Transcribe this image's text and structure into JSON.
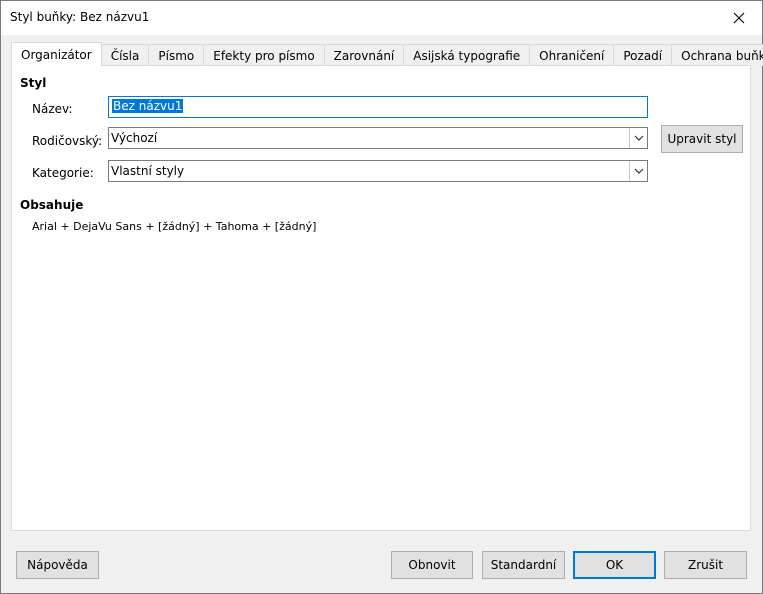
{
  "window": {
    "title": "Styl buňky: Bez názvu1"
  },
  "icons": {
    "close": "close-icon",
    "dropdown": "chevron-down-icon"
  },
  "tabs": [
    {
      "label": "Organizátor",
      "active": true
    },
    {
      "label": "Čísla",
      "active": false
    },
    {
      "label": "Písmo",
      "active": false
    },
    {
      "label": "Efekty pro písmo",
      "active": false
    },
    {
      "label": "Zarovnání",
      "active": false
    },
    {
      "label": "Asijská typografie",
      "active": false
    },
    {
      "label": "Ohraničení",
      "active": false
    },
    {
      "label": "Pozadí",
      "active": false
    },
    {
      "label": "Ochrana buňky",
      "active": false
    }
  ],
  "style_section": {
    "heading": "Styl",
    "name_label": "Název:",
    "name_value": "Bez názvu1",
    "parent_label": "Rodičovský:",
    "parent_value": "Výchozí",
    "edit_style_button": "Upravit styl",
    "category_label": "Kategorie:",
    "category_value": "Vlastní styly"
  },
  "contains_section": {
    "heading": "Obsahuje",
    "text": "Arial + DejaVu Sans + [žádný] + Tahoma + [žádný]"
  },
  "footer": {
    "help_button": "Nápověda",
    "reset_button": "Obnovit",
    "standard_button": "Standardní",
    "ok_button": "OK",
    "cancel_button": "Zrušit"
  },
  "colors": {
    "accent": "#0078d7",
    "dialog_bg": "#f0f0f0",
    "panel_bg": "#ffffff"
  }
}
